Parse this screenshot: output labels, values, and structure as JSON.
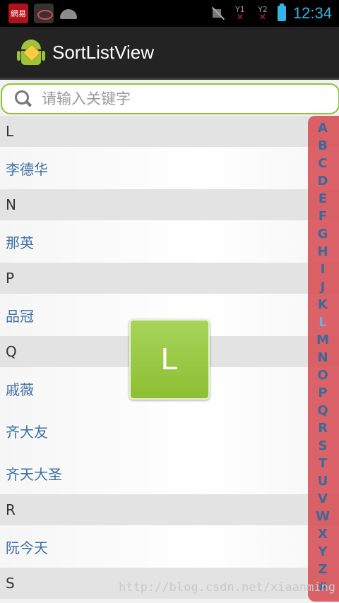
{
  "statusbar": {
    "time": "12:34",
    "sim1": "1",
    "sim2": "2",
    "netease_label": "網易"
  },
  "actionbar": {
    "title": "SortListView"
  },
  "search": {
    "placeholder": "请输入关键字"
  },
  "list": {
    "rows": [
      {
        "type": "header",
        "text": "L"
      },
      {
        "type": "item",
        "text": "李德华"
      },
      {
        "type": "header",
        "text": "N"
      },
      {
        "type": "item",
        "text": "那英"
      },
      {
        "type": "header",
        "text": "P"
      },
      {
        "type": "item",
        "text": "品冠"
      },
      {
        "type": "header",
        "text": "Q"
      },
      {
        "type": "item",
        "text": "戚薇"
      },
      {
        "type": "item",
        "text": "齐大友"
      },
      {
        "type": "item",
        "text": "齐天大圣"
      },
      {
        "type": "header",
        "text": "R"
      },
      {
        "type": "item",
        "text": "阮今天"
      },
      {
        "type": "header",
        "text": "S"
      }
    ]
  },
  "sidebar": {
    "letters": [
      "A",
      "B",
      "C",
      "D",
      "E",
      "F",
      "G",
      "H",
      "I",
      "J",
      "K",
      "L",
      "M",
      "N",
      "O",
      "P",
      "Q",
      "R",
      "S",
      "T",
      "U",
      "V",
      "W",
      "X",
      "Y",
      "Z",
      "#"
    ],
    "active": "L"
  },
  "overlay": {
    "letter": "L"
  },
  "watermark": "http://blog.csdn.net/xiaanming"
}
